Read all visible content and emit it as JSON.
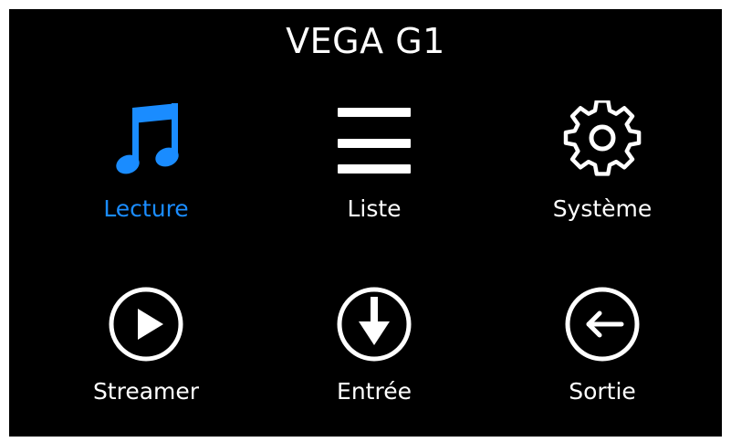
{
  "device": {
    "title": "VEGA G1"
  },
  "colors": {
    "background": "#000000",
    "text": "#ffffff",
    "accent": "#1a8cff"
  },
  "menu": {
    "selected_index": 0,
    "items": [
      {
        "label": "Lecture",
        "icon": "music-note-icon",
        "selected": true
      },
      {
        "label": "Liste",
        "icon": "list-icon",
        "selected": false
      },
      {
        "label": "Système",
        "icon": "gear-icon",
        "selected": false
      },
      {
        "label": "Streamer",
        "icon": "play-circle-icon",
        "selected": false
      },
      {
        "label": "Entrée",
        "icon": "input-arrow-down-circle-icon",
        "selected": false
      },
      {
        "label": "Sortie",
        "icon": "exit-arrow-left-circle-icon",
        "selected": false
      }
    ]
  }
}
